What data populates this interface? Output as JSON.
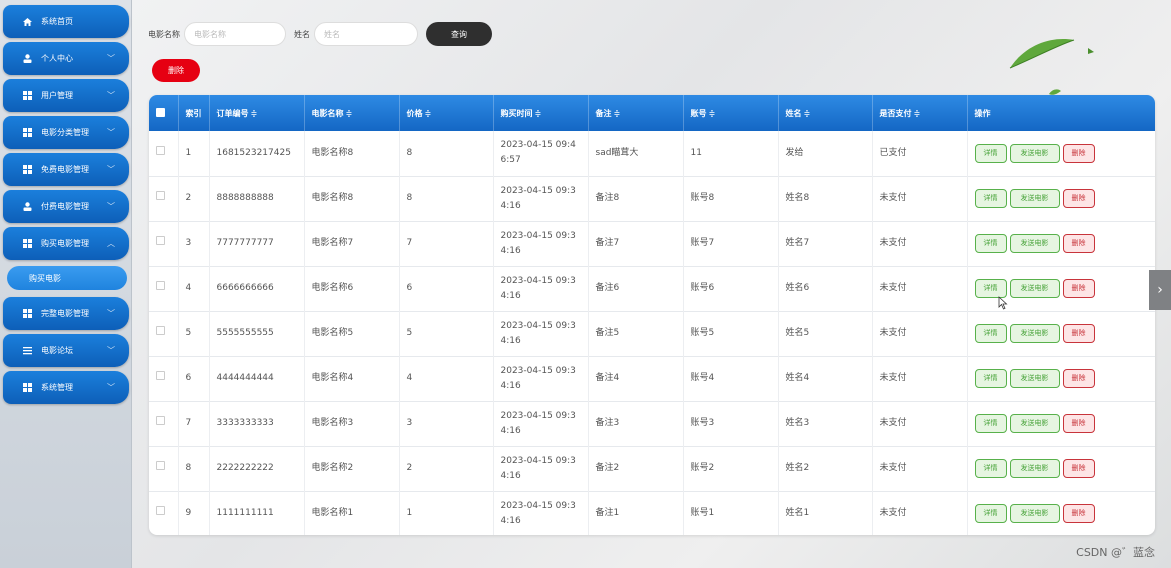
{
  "sidebar": {
    "items": [
      {
        "label": "系统首页",
        "icon": "home-icon",
        "chevron": ""
      },
      {
        "label": "个人中心",
        "icon": "user-icon",
        "chevron": "﹀"
      },
      {
        "label": "用户管理",
        "icon": "grid-icon",
        "chevron": "﹀"
      },
      {
        "label": "电影分类管理",
        "icon": "grid-icon",
        "chevron": "﹀"
      },
      {
        "label": "免费电影管理",
        "icon": "grid-icon",
        "chevron": "﹀"
      },
      {
        "label": "付费电影管理",
        "icon": "user-icon",
        "chevron": "﹀"
      },
      {
        "label": "购买电影管理",
        "icon": "grid-icon",
        "chevron": "︿"
      },
      {
        "label": "完整电影管理",
        "icon": "grid-icon",
        "chevron": "﹀"
      },
      {
        "label": "电影论坛",
        "icon": "list-icon",
        "chevron": "﹀"
      },
      {
        "label": "系统管理",
        "icon": "grid-icon",
        "chevron": "﹀"
      }
    ],
    "active_sub": "购买电影"
  },
  "search": {
    "movie_label": "电影名称",
    "movie_placeholder": "电影名称",
    "name_label": "姓名",
    "name_placeholder": "姓名",
    "query_label": "查询"
  },
  "toolbar": {
    "delete_label": "删除"
  },
  "table": {
    "headers": {
      "index": "索引",
      "order": "订单编号",
      "movie": "电影名称",
      "price": "价格",
      "time": "购买时间",
      "remark": "备注",
      "account": "账号",
      "name": "姓名",
      "paid": "是否支付",
      "actions": "操作"
    },
    "sort_glyph": "≑",
    "action_labels": {
      "detail": "详情",
      "send": "发送电影",
      "delete": "删除"
    },
    "rows": [
      {
        "index": "1",
        "order": "1681523217425",
        "movie": "电影名称8",
        "price": "8",
        "time": "2023-04-15 09:46:57",
        "remark": "sad瞄茸大",
        "account": "11",
        "name": "发给",
        "paid": "已支付"
      },
      {
        "index": "2",
        "order": "8888888888",
        "movie": "电影名称8",
        "price": "8",
        "time": "2023-04-15 09:34:16",
        "remark": "备注8",
        "account": "账号8",
        "name": "姓名8",
        "paid": "未支付"
      },
      {
        "index": "3",
        "order": "7777777777",
        "movie": "电影名称7",
        "price": "7",
        "time": "2023-04-15 09:34:16",
        "remark": "备注7",
        "account": "账号7",
        "name": "姓名7",
        "paid": "未支付"
      },
      {
        "index": "4",
        "order": "6666666666",
        "movie": "电影名称6",
        "price": "6",
        "time": "2023-04-15 09:34:16",
        "remark": "备注6",
        "account": "账号6",
        "name": "姓名6",
        "paid": "未支付"
      },
      {
        "index": "5",
        "order": "5555555555",
        "movie": "电影名称5",
        "price": "5",
        "time": "2023-04-15 09:34:16",
        "remark": "备注5",
        "account": "账号5",
        "name": "姓名5",
        "paid": "未支付"
      },
      {
        "index": "6",
        "order": "4444444444",
        "movie": "电影名称4",
        "price": "4",
        "time": "2023-04-15 09:34:16",
        "remark": "备注4",
        "account": "账号4",
        "name": "姓名4",
        "paid": "未支付"
      },
      {
        "index": "7",
        "order": "3333333333",
        "movie": "电影名称3",
        "price": "3",
        "time": "2023-04-15 09:34:16",
        "remark": "备注3",
        "account": "账号3",
        "name": "姓名3",
        "paid": "未支付"
      },
      {
        "index": "8",
        "order": "2222222222",
        "movie": "电影名称2",
        "price": "2",
        "time": "2023-04-15 09:34:16",
        "remark": "备注2",
        "account": "账号2",
        "name": "姓名2",
        "paid": "未支付"
      },
      {
        "index": "9",
        "order": "1111111111",
        "movie": "电影名称1",
        "price": "1",
        "time": "2023-04-15 09:34:16",
        "remark": "备注1",
        "account": "账号1",
        "name": "姓名1",
        "paid": "未支付"
      }
    ]
  },
  "right_handle": "›",
  "watermark": "CSDN @゛蓝念",
  "colors": {
    "nav_blue": "#0d5fb8",
    "header_blue": "#1467c4",
    "delete_red": "#e60012",
    "query_dark": "#2f2f2f",
    "detail_green": "#48a33a",
    "danger_red": "#c8343b"
  }
}
